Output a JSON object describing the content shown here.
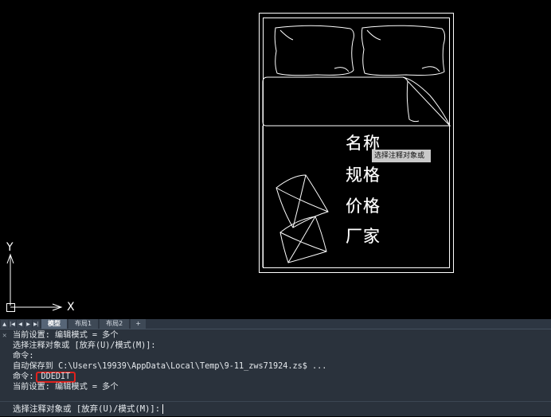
{
  "drawing": {
    "labels": [
      "名称",
      "规格",
      "价格",
      "厂家"
    ],
    "axis_x": "X",
    "axis_y": "Y"
  },
  "tooltip": {
    "text": "选择注释对象或"
  },
  "tabs": {
    "items": [
      "模型",
      "布局1",
      "布局2",
      "+"
    ],
    "active": "模型"
  },
  "command": {
    "history": [
      "当前设置: 编辑模式 = 多个",
      "选择注释对象或 [放弃(U)/模式(M)]:",
      "命令:",
      "自动保存到 C:\\Users\\19939\\AppData\\Local\\Temp\\9-11_zws71924.zs$ ...",
      "命令:",
      "当前设置: 编辑模式 = 多个"
    ],
    "entered_command": "DDEDIT",
    "prompt": "选择注释对象或 [放弃(U)/模式(M)]:"
  },
  "colors": {
    "highlight": "#e0221e",
    "background": "#000000",
    "panel": "#2a323c"
  }
}
